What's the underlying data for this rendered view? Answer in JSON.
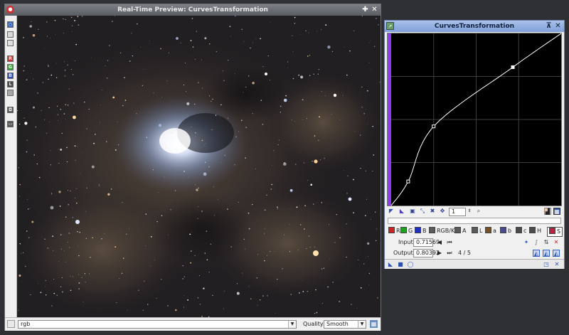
{
  "colors": {
    "preview_title_bg": "#5f6268",
    "curves_title_bg": "#8aa7dd",
    "curve": "#ffffff",
    "grid": "#3e3e3e",
    "violet_bar": "#8b3cf0"
  },
  "preview": {
    "title": "Real-Time Preview: CurvesTransformation",
    "pin_icon": "✚",
    "close_icon": "✕",
    "toolstrip": [
      {
        "name": "preview-icon",
        "label": "○",
        "color": "#2e65c8"
      },
      {
        "name": "page-icon",
        "label": "",
        "color": "#d8d8d8"
      },
      {
        "name": "page-alt-icon",
        "label": "",
        "color": "#e0e0e0"
      },
      {
        "name": "red-channel-icon",
        "label": "R",
        "color": "#d63030"
      },
      {
        "name": "green-channel-icon",
        "label": "G",
        "color": "#2eaa2e"
      },
      {
        "name": "blue-channel-icon",
        "label": "B",
        "color": "#2e4ec8"
      },
      {
        "name": "luminance-channel-icon",
        "label": "L",
        "color": "#4a4a4a"
      },
      {
        "name": "alpha-channel-icon",
        "label": "",
        "color": "#a8a8a8"
      },
      {
        "name": "camera-icon",
        "label": "◘",
        "color": "#555555"
      },
      {
        "name": "screen-icon",
        "label": "▭",
        "color": "#555555"
      }
    ],
    "mode": "rgb",
    "quality_label": "Quality:",
    "quality_value": "Smooth",
    "settings_icon": "▦"
  },
  "curves": {
    "title": "CurvesTransformation",
    "pin_icon": "⊼",
    "close_icon": "✕",
    "curve_points": [
      [
        0,
        0
      ],
      [
        0.1,
        0.14
      ],
      [
        0.25,
        0.46
      ],
      [
        0.71569,
        0.80392
      ],
      [
        1,
        1
      ]
    ],
    "selected_point": 3,
    "zoom_value": "1",
    "channels": [
      {
        "key": "R",
        "color": "#d32020"
      },
      {
        "key": "G",
        "color": "#22a022"
      },
      {
        "key": "B",
        "color": "#2030c0"
      },
      {
        "key": "RGB/K",
        "color": "#5a5a5a"
      },
      {
        "key": "A",
        "color": "#5a5a5a"
      },
      {
        "key": "L",
        "color": "#5a5a5a"
      },
      {
        "key": "a",
        "color": "#7a5020"
      },
      {
        "key": "b",
        "color": "#4a4a8a"
      },
      {
        "key": "c",
        "color": "#4a4a4a"
      },
      {
        "key": "H",
        "color": "#4a4a4a"
      },
      {
        "key": "S",
        "color": "#c02040"
      }
    ],
    "input_label": "Input:",
    "input_value": "0.71569",
    "output_label": "Output:",
    "output_value": "0.80392",
    "point_counter": "4 / 5"
  }
}
